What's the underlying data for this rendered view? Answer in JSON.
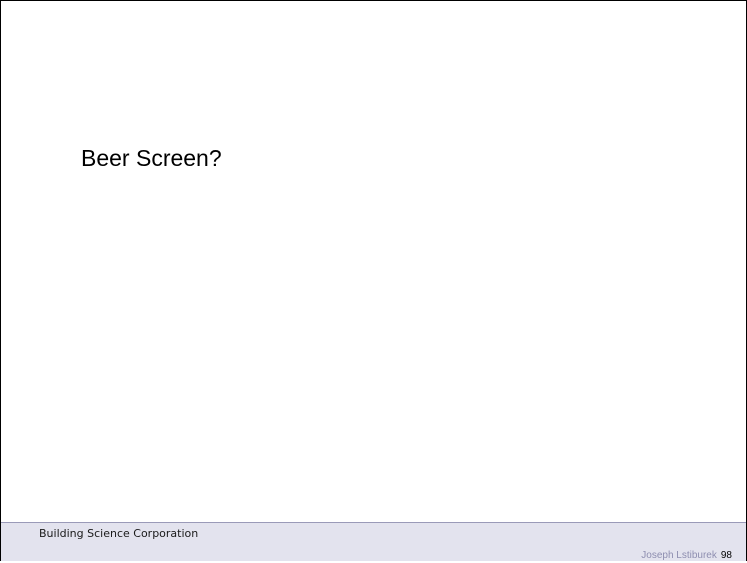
{
  "slide": {
    "title": "Beer Screen?"
  },
  "footer": {
    "organization": "Building Science Corporation",
    "author": "Joseph Lstiburek",
    "page_number": "98"
  },
  "colors": {
    "footer_background": "#e3e3ee",
    "footer_author_text": "#8e8eb0"
  }
}
